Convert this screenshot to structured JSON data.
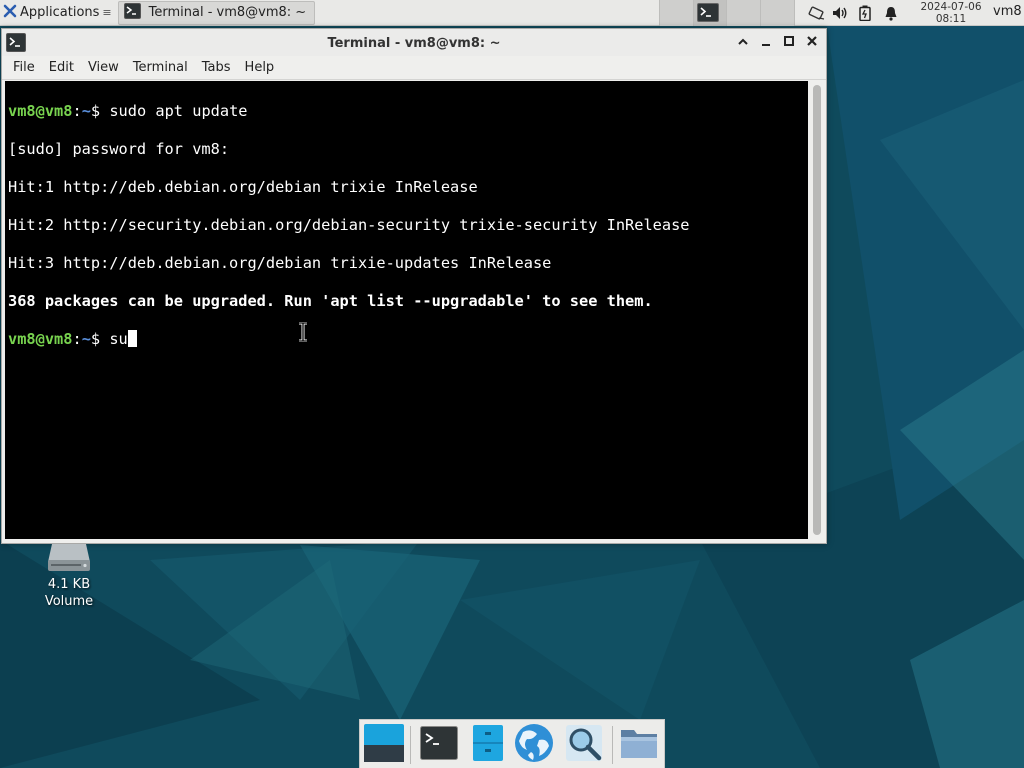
{
  "top_panel": {
    "applications_label": "Applications",
    "task_title": "Terminal - vm8@vm8: ~",
    "clock_date": "2024-07-06",
    "clock_time": "08:11",
    "user": "vm8"
  },
  "window": {
    "title": "Terminal - vm8@vm8: ~",
    "menu": [
      "File",
      "Edit",
      "View",
      "Terminal",
      "Tabs",
      "Help"
    ]
  },
  "terminal": {
    "prompt_user": "vm8@vm8",
    "prompt_path": "~",
    "prompt_symbol": "$",
    "lines": [
      "[sudo] password for vm8:",
      "Hit:1 http://deb.debian.org/debian trixie InRelease",
      "Hit:2 http://security.debian.org/debian-security trixie-security InRelease",
      "Hit:3 http://deb.debian.org/debian trixie-updates InRelease",
      "368 packages can be upgraded. Run 'apt list --upgradable' to see them."
    ],
    "command_1": "sudo apt update",
    "current_input": "su"
  },
  "desktop_icons": {
    "volume_size": "4.1 KB",
    "volume_label": "Volume"
  },
  "dock": {
    "items": [
      "show-desktop-icon",
      "terminal-icon",
      "file-manager-icon",
      "web-browser-icon",
      "app-finder-icon",
      "folder-icon"
    ]
  },
  "colors": {
    "prompt_user": "#78d34f",
    "prompt_path": "#5a8fdc",
    "terminal_bg": "#000000",
    "wallpaper": "#0f4a5c"
  }
}
